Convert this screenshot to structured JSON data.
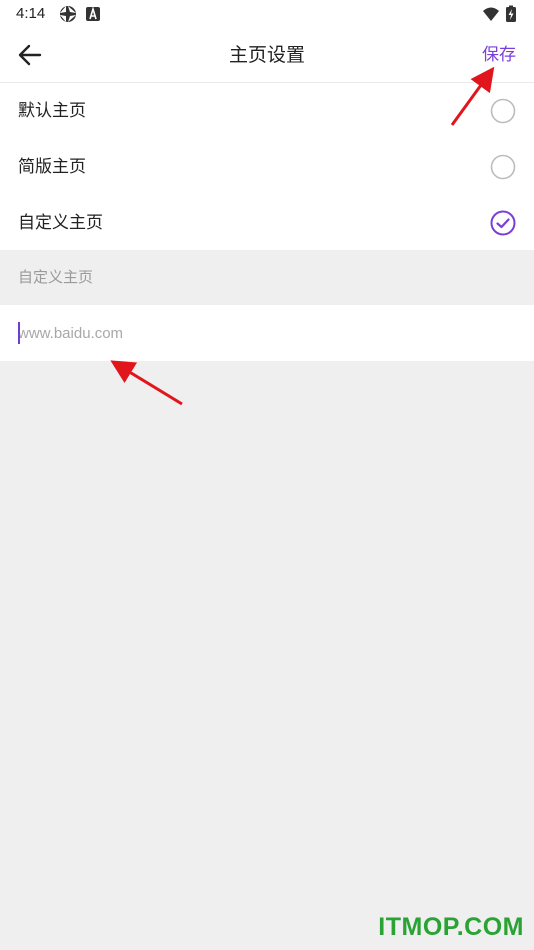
{
  "status_bar": {
    "time": "4:14",
    "icons": [
      "aperture-icon",
      "a-badge-icon",
      "wifi-icon",
      "battery-charging-icon"
    ]
  },
  "header": {
    "title": "主页设置",
    "save_label": "保存",
    "back_icon": "arrow-left-icon"
  },
  "options": [
    {
      "label": "默认主页",
      "selected": false
    },
    {
      "label": "简版主页",
      "selected": false
    },
    {
      "label": "自定义主页",
      "selected": true
    }
  ],
  "custom_section": {
    "header": "自定义主页",
    "url_placeholder": "www.baidu.com",
    "url_value": ""
  },
  "watermark": "ITMOP.COM",
  "colors": {
    "accent": "#7b3fd8",
    "annotation_arrow": "#e0161c",
    "watermark": "#2aa334"
  }
}
